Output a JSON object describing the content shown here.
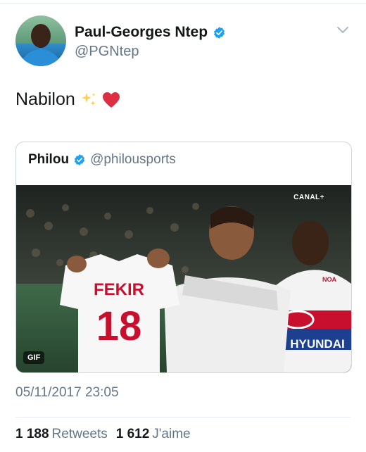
{
  "tweet": {
    "author": {
      "name": "Paul-Georges Ntep",
      "handle": "@PGNtep",
      "verified": true
    },
    "text": "Nabilon",
    "emojis": [
      "sparkles-icon",
      "red-heart-icon"
    ],
    "timestamp": "05/11/2017 23:05",
    "stats": {
      "retweets_count": "1 188",
      "retweets_label": "Retweets",
      "likes_count": "1 612",
      "likes_label": "J'aime"
    }
  },
  "quote": {
    "author": {
      "name": "Philou",
      "handle": "@philousports",
      "verified": true
    },
    "media": {
      "type": "gif",
      "badge": "GIF",
      "broadcaster": "CANAL+",
      "jersey_name": "FEKIR",
      "jersey_number": "18",
      "sponsor_top": "NOA",
      "sponsor_main": "HYUNDAI"
    }
  },
  "colors": {
    "text": "#14171a",
    "secondary": "#657786",
    "verified": "#1da1f2",
    "border": "#ccd6dd",
    "heart": "#e0245e"
  }
}
